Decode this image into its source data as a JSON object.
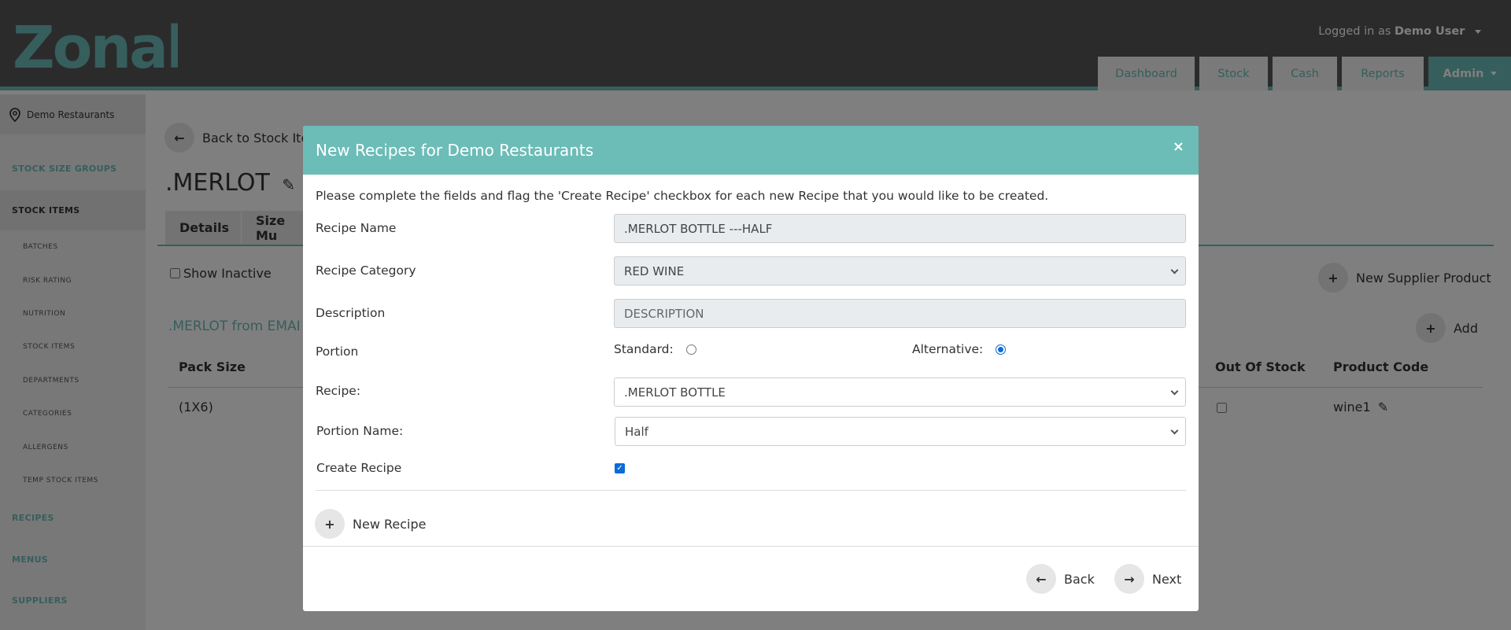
{
  "header": {
    "logo_text": "Zonal",
    "user_prefix": "Logged in as",
    "user_name": "Demo User",
    "nav": [
      {
        "label": "Dashboard"
      },
      {
        "label": "Stock"
      },
      {
        "label": "Cash"
      },
      {
        "label": "Reports"
      },
      {
        "label": "Admin"
      }
    ]
  },
  "sidebar": {
    "location": "Demo Restaurants",
    "items": [
      {
        "label": "STOCK SIZE GROUPS"
      },
      {
        "label": "STOCK ITEMS"
      },
      {
        "label": "RECIPES"
      },
      {
        "label": "MENUS"
      },
      {
        "label": "SUPPLIERS"
      }
    ],
    "subitems": [
      {
        "label": "BATCHES"
      },
      {
        "label": "RISK RATING"
      },
      {
        "label": "NUTRITION"
      },
      {
        "label": "STOCK ITEMS"
      },
      {
        "label": "DEPARTMENTS"
      },
      {
        "label": "CATEGORIES"
      },
      {
        "label": "ALLERGENS"
      },
      {
        "label": "TEMP STOCK ITEMS"
      }
    ]
  },
  "page": {
    "back_label": "Back to Stock Ite",
    "title": ".MERLOT",
    "tabs": [
      {
        "label": "Details"
      },
      {
        "label": "Size Mu"
      }
    ],
    "show_inactive": "Show Inactive",
    "new_supplier_product": "New Supplier Product",
    "add_label": "Add",
    "section_title": ".MERLOT from EMAI",
    "table": {
      "headers": [
        "Pack Size",
        "Out Of Stock",
        "Product Code"
      ],
      "row": {
        "pack_size": "(1X6)",
        "product_code": "wine1"
      }
    }
  },
  "modal": {
    "title": "New Recipes for Demo Restaurants",
    "close": "×",
    "instructions": "Please complete the fields and flag the 'Create Recipe' checkbox for each new Recipe that you would like to be created.",
    "recipe_name_label": "Recipe Name",
    "recipe_name_value": ".MERLOT BOTTLE ---HALF",
    "recipe_category_label": "Recipe Category",
    "recipe_category_value": "RED WINE",
    "description_label": "Description",
    "description_placeholder": "DESCRIPTION",
    "portion_label": "Portion",
    "standard_label": "Standard:",
    "alternative_label": "Alternative:",
    "recipe_label": "Recipe:",
    "recipe_value": ".MERLOT BOTTLE",
    "portion_name_label": "Portion Name:",
    "portion_name_value": "Half",
    "create_recipe_label": "Create Recipe",
    "new_recipe_label": "New Recipe",
    "back_label": "Back",
    "next_label": "Next"
  }
}
